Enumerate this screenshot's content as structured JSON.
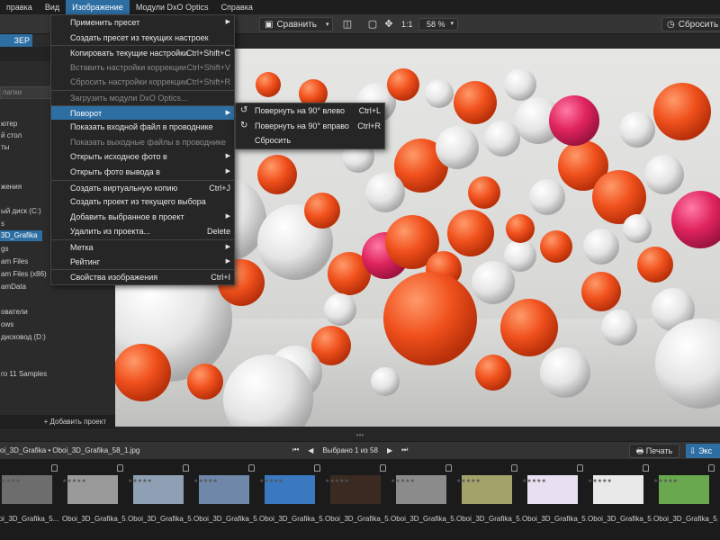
{
  "menubar": {
    "items": [
      "правка",
      "Вид",
      "Изображение",
      "Модули DxO Optics",
      "Справка"
    ]
  },
  "toolbar": {
    "compare_label": "Сравнить",
    "zoom_ratio": "1:1",
    "zoom_value": "58 %",
    "reset_label": "Сбросить"
  },
  "left": {
    "header": "ЗЕР",
    "search_placeholder": "папки",
    "tree": [
      "ютер",
      "й стол",
      "ты",
      "жения",
      "ый диск (C:)",
      "s",
      "3D_Grafika",
      "gs",
      "am Files",
      "am Files (x86)",
      "amData",
      "ователи",
      "ows",
      "дисковод (D:)",
      "го 11 Samples"
    ],
    "add_project": "+ Добавить проект"
  },
  "image_menu": {
    "items": [
      {
        "label": "Применить пресет",
        "shortcut": "",
        "submenu": true,
        "disabled": false
      },
      {
        "label": "Создать пресет из текущих настроек",
        "shortcut": "",
        "submenu": false,
        "disabled": false
      },
      {
        "label": "Копировать текущие настройки",
        "shortcut": "Ctrl+Shift+C",
        "submenu": false,
        "disabled": false,
        "sep": true
      },
      {
        "label": "Вставить настройки коррекции",
        "shortcut": "Ctrl+Shift+V",
        "submenu": false,
        "disabled": true
      },
      {
        "label": "Сбросить настройки коррекции",
        "shortcut": "Ctrl+Shift+R",
        "submenu": false,
        "disabled": true
      },
      {
        "label": "Загрузить модули DxO Optics...",
        "shortcut": "",
        "submenu": false,
        "disabled": true,
        "sep": true
      },
      {
        "label": "Поворот",
        "shortcut": "",
        "submenu": true,
        "disabled": false,
        "highlight": true,
        "sep": true
      },
      {
        "label": "Показать входной файл в проводнике",
        "shortcut": "",
        "submenu": false,
        "disabled": false
      },
      {
        "label": "Показать выходные файлы в проводнике",
        "shortcut": "",
        "submenu": false,
        "disabled": true
      },
      {
        "label": "Открыть исходное фото в",
        "shortcut": "",
        "submenu": true,
        "disabled": false
      },
      {
        "label": "Открыть фото вывода в",
        "shortcut": "",
        "submenu": true,
        "disabled": false
      },
      {
        "label": "Создать виртуальную копию",
        "shortcut": "Ctrl+J",
        "submenu": false,
        "disabled": false,
        "sep": true
      },
      {
        "label": "Создать проект из текущего выбора",
        "shortcut": "",
        "submenu": false,
        "disabled": false
      },
      {
        "label": "Добавить выбранное в проект",
        "shortcut": "",
        "submenu": true,
        "disabled": false
      },
      {
        "label": "Удалить из проекта...",
        "shortcut": "Delete",
        "submenu": false,
        "disabled": false
      },
      {
        "label": "Метка",
        "shortcut": "",
        "submenu": true,
        "disabled": false,
        "sep": true
      },
      {
        "label": "Рейтинг",
        "shortcut": "",
        "submenu": true,
        "disabled": false
      },
      {
        "label": "Свойства изображения",
        "shortcut": "Ctrl+I",
        "submenu": false,
        "disabled": false,
        "sep": true
      }
    ]
  },
  "rotate_menu": {
    "items": [
      {
        "label": "Повернуть на 90° влево",
        "shortcut": "Ctrl+L",
        "icon": "rotate-left-icon",
        "glyph": "↺"
      },
      {
        "label": "Повернуть на 90° вправо",
        "shortcut": "Ctrl+R",
        "icon": "rotate-right-icon",
        "glyph": "↻"
      },
      {
        "label": "Сбросить",
        "shortcut": "",
        "icon": "",
        "glyph": ""
      }
    ]
  },
  "filmbar": {
    "path": "oi_3D_Grafika  •  Oboi_3D_Grafika_58_1.jpg",
    "selection": "Выбрано 1 из 58",
    "print_label": "Печать",
    "export_label": "Экс"
  },
  "filmstrip": {
    "thumbnails": [
      {
        "name": "oi_3D_Grafika_5...",
        "color": "#6d6d6d"
      },
      {
        "name": "Oboi_3D_Grafika_5...",
        "color": "#9a9a9a"
      },
      {
        "name": "Oboi_3D_Grafika_5...",
        "color": "#8fa0b5"
      },
      {
        "name": "Oboi_3D_Grafika_5...",
        "color": "#6f87a8"
      },
      {
        "name": "Oboi_3D_Grafika_5...",
        "color": "#3a79c0"
      },
      {
        "name": "Oboi_3D_Grafika_5...",
        "color": "#3a2a22"
      },
      {
        "name": "Oboi_3D_Grafika_5...",
        "color": "#8b8b8b"
      },
      {
        "name": "Oboi_3D_Grafika_5...",
        "color": "#a3a26b"
      },
      {
        "name": "Oboi_3D_Grafika_5...",
        "color": "#e8e0f0"
      },
      {
        "name": "Oboi_3D_Grafika_5...",
        "color": "#e9e9e9"
      },
      {
        "name": "Oboi_3D_Grafika_5...",
        "color": "#6aa84f"
      }
    ]
  }
}
